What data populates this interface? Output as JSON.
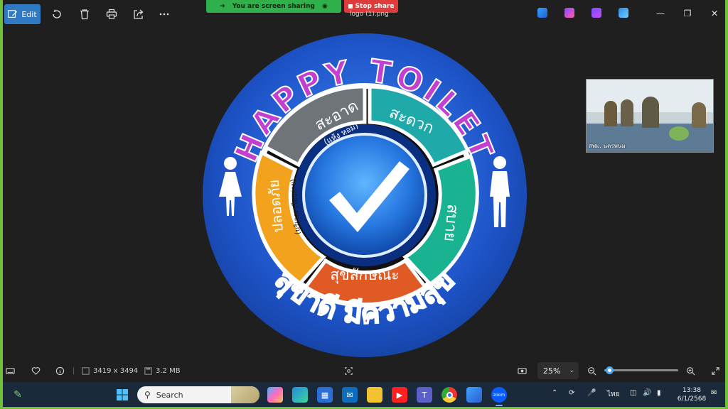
{
  "toolbar": {
    "edit_label": "Edit",
    "file_name": "logo (1).png"
  },
  "screen_share": {
    "banner_text": "You are screen sharing",
    "stop_label": "Stop share"
  },
  "logo": {
    "top_text": "HAPPY TOILET",
    "bottom_text": "สุขาดี มีความสุข",
    "segments": [
      {
        "label": "สะอาด",
        "sublabel": "(แห้ง หอม)",
        "color": "#6f7478"
      },
      {
        "label": "สะดวก",
        "sublabel": "",
        "color": "#1fa9a8"
      },
      {
        "label": "สบาย",
        "sublabel": "",
        "color": "#1ab391"
      },
      {
        "label": "สุขลักษณะ",
        "sublabel": "",
        "color": "#e05a26"
      },
      {
        "label": "ปลอดภัย",
        "sublabel": "(บริเวณ เรียบง่าย)",
        "color": "#f2a21c"
      }
    ],
    "colors": {
      "ring": "#1e54c9",
      "text": "#c23fd0",
      "figure": "#ffffff"
    }
  },
  "video": {
    "participant_name": "สพม. นครพนม"
  },
  "statusbar": {
    "dimensions": "3419 x 3494",
    "file_size": "3.2 MB",
    "zoom_label": "25%",
    "zoom_fraction": 0.07
  },
  "taskbar": {
    "search_placeholder": "Search",
    "language": "ไทย",
    "time": "13:38",
    "date": "6/1/2568",
    "apps": [
      "start-icon",
      "copilot-icon",
      "edge-icon",
      "store-icon",
      "outlook-icon",
      "file-explorer-icon",
      "youtube-icon",
      "teams-icon",
      "chrome-icon",
      "photos-icon",
      "zoom-icon"
    ]
  }
}
